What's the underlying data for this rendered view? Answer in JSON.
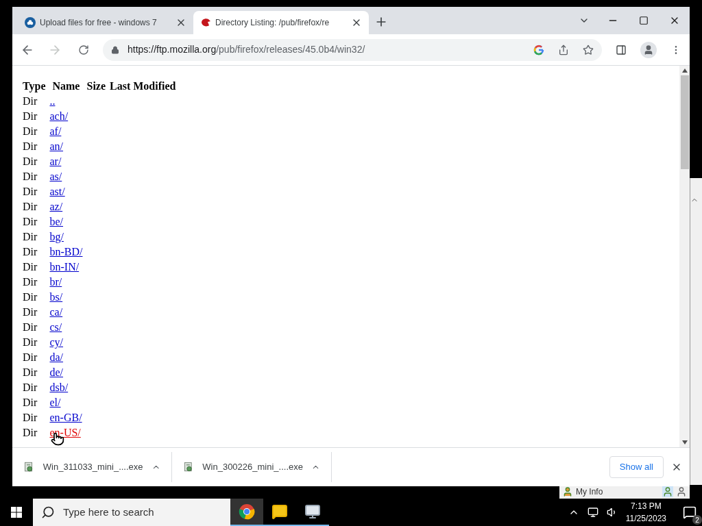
{
  "browser": {
    "tabs": [
      {
        "title": "Upload files for free - windows 7",
        "selected": false
      },
      {
        "title": "Directory Listing: /pub/firefox/re",
        "selected": true
      }
    ],
    "url": {
      "host": "https://ftp.mozilla.org",
      "path": "/pub/firefox/releases/45.0b4/win32/"
    }
  },
  "listing": {
    "columns": [
      "Type",
      "Name",
      "Size",
      "Last Modified"
    ],
    "rows": [
      {
        "type": "Dir",
        "name": "..",
        "active": false
      },
      {
        "type": "Dir",
        "name": "ach/",
        "active": false
      },
      {
        "type": "Dir",
        "name": "af/",
        "active": false
      },
      {
        "type": "Dir",
        "name": "an/",
        "active": false
      },
      {
        "type": "Dir",
        "name": "ar/",
        "active": false
      },
      {
        "type": "Dir",
        "name": "as/",
        "active": false
      },
      {
        "type": "Dir",
        "name": "ast/",
        "active": false
      },
      {
        "type": "Dir",
        "name": "az/",
        "active": false
      },
      {
        "type": "Dir",
        "name": "be/",
        "active": false
      },
      {
        "type": "Dir",
        "name": "bg/",
        "active": false
      },
      {
        "type": "Dir",
        "name": "bn-BD/",
        "active": false
      },
      {
        "type": "Dir",
        "name": "bn-IN/",
        "active": false
      },
      {
        "type": "Dir",
        "name": "br/",
        "active": false
      },
      {
        "type": "Dir",
        "name": "bs/",
        "active": false
      },
      {
        "type": "Dir",
        "name": "ca/",
        "active": false
      },
      {
        "type": "Dir",
        "name": "cs/",
        "active": false
      },
      {
        "type": "Dir",
        "name": "cy/",
        "active": false
      },
      {
        "type": "Dir",
        "name": "da/",
        "active": false
      },
      {
        "type": "Dir",
        "name": "de/",
        "active": false
      },
      {
        "type": "Dir",
        "name": "dsb/",
        "active": false
      },
      {
        "type": "Dir",
        "name": "el/",
        "active": false
      },
      {
        "type": "Dir",
        "name": "en-GB/",
        "active": false
      },
      {
        "type": "Dir",
        "name": "en-US/",
        "active": true
      }
    ]
  },
  "downloads": {
    "items": [
      {
        "file": "Win_311033_mini_....exe"
      },
      {
        "file": "Win_300226_mini_....exe"
      }
    ],
    "show_all": "Show all"
  },
  "background_window": {
    "label": "My Info"
  },
  "taskbar": {
    "search_placeholder": "Type here to search",
    "apps": [
      {
        "kind": "chrome",
        "active": true
      },
      {
        "kind": "chat",
        "active": false
      },
      {
        "kind": "monitor",
        "active": false
      }
    ],
    "time": "7:13 PM",
    "date": "11/25/2023",
    "notifications": "2"
  }
}
